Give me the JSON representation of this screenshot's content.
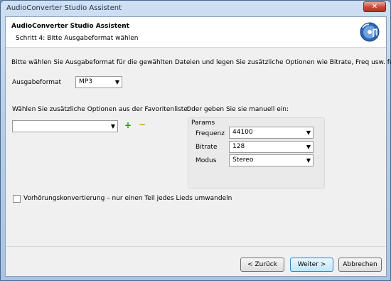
{
  "window": {
    "title": "AudioConverter Studio Assistent",
    "close_glyph": "✕"
  },
  "header": {
    "title": "AudioConverter Studio Assistent",
    "subtitle": "Schritt 4: Bitte Ausgabeformat wählen",
    "icon": "audio-cd-icon"
  },
  "intro_text": "Bitte wählen Sie Ausgabeformat für die gewählten Dateien und legen Sie zusätzliche Optionen wie Bitrate, Freq usw. fest.",
  "format": {
    "label": "Ausgabeformat",
    "value": "MP3"
  },
  "favorites": {
    "label": "Wählen Sie zusätzliche Optionen aus der Favoritenliste:",
    "value": "",
    "add_glyph": "+",
    "remove_glyph": "−"
  },
  "manual": {
    "label": "Oder geben Sie sie manuell ein:",
    "group_title": "Params",
    "fields": [
      {
        "label": "Frequenz",
        "value": "44100"
      },
      {
        "label": "Bitrate",
        "value": "128"
      },
      {
        "label": "Modus",
        "value": "Stereo"
      }
    ]
  },
  "preview": {
    "label": "Vorhörungskonvertierung – nur einen Teil jedes Lieds umwandeln",
    "checked": false
  },
  "buttons": {
    "back": "< Zurück",
    "next": "Weiter >",
    "cancel": "Abbrechen"
  },
  "colors": {
    "add_icon": "#2f9a1c",
    "remove_icon": "#c89a12"
  }
}
